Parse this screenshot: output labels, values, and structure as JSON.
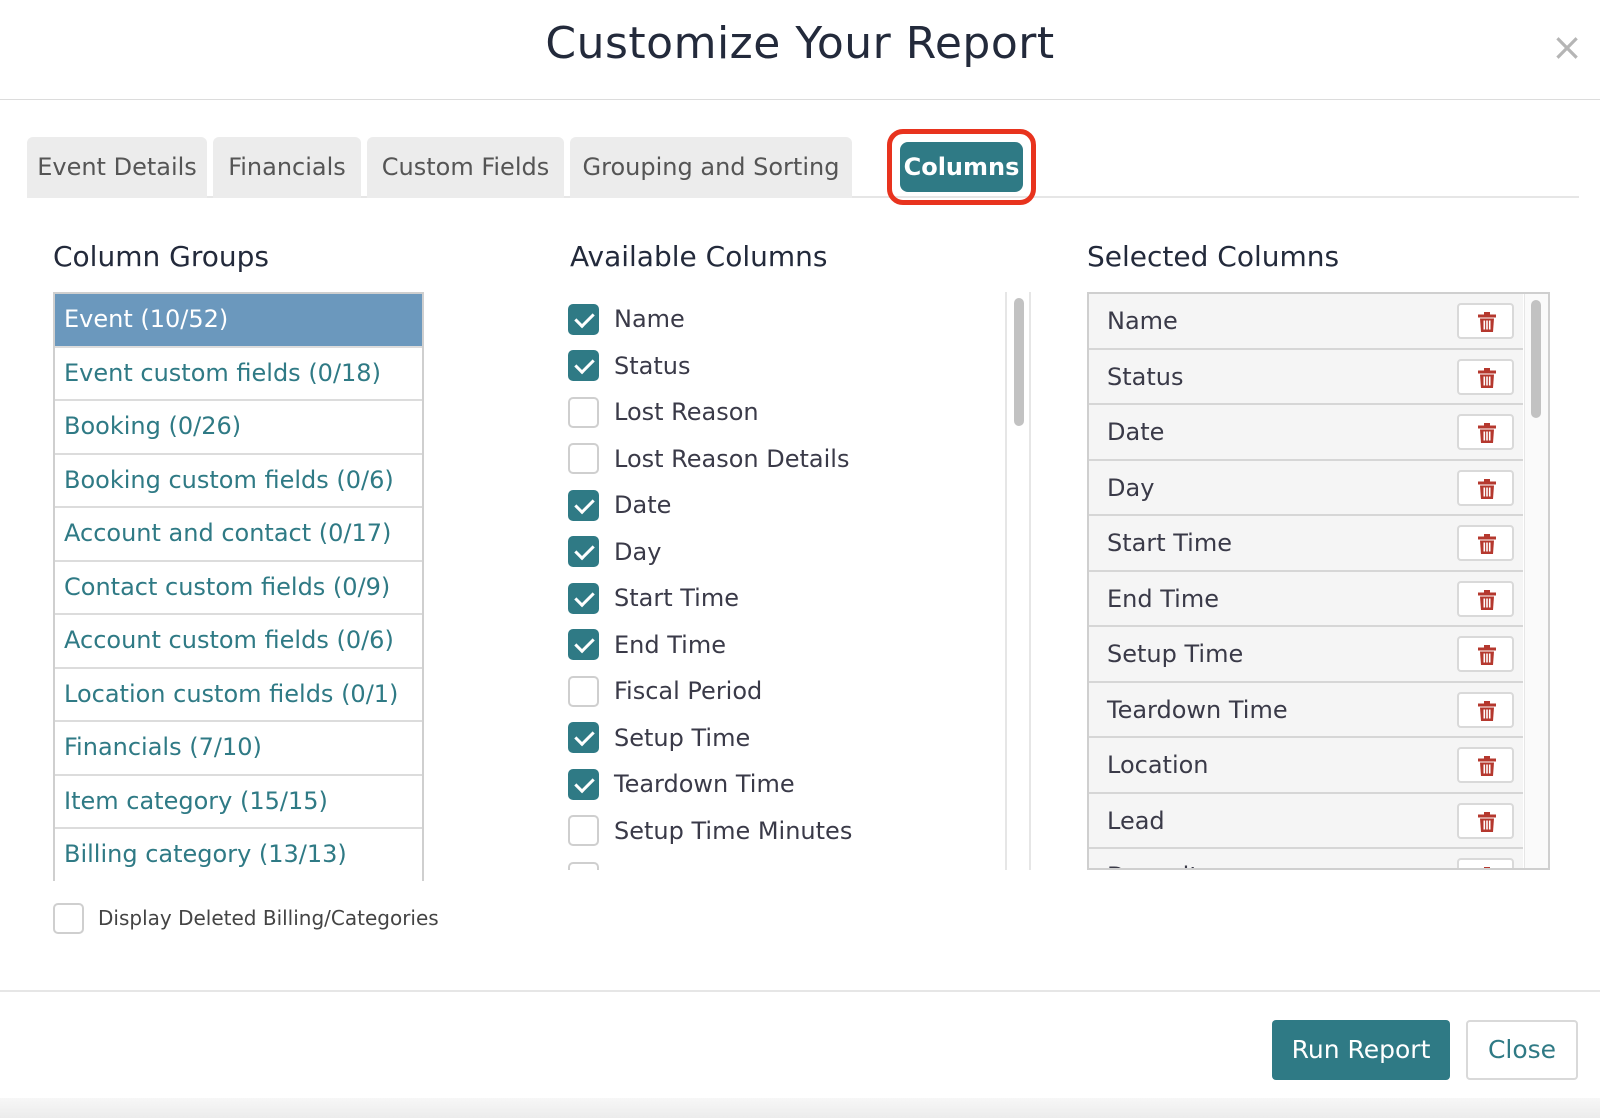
{
  "dialog": {
    "title": "Customize Your Report",
    "close_glyph": "×"
  },
  "tabs": [
    {
      "label": "Event Details"
    },
    {
      "label": "Financials"
    },
    {
      "label": "Custom Fields"
    },
    {
      "label": "Grouping and Sorting"
    },
    {
      "label": "Columns",
      "active": true
    }
  ],
  "column_groups": {
    "heading": "Column Groups",
    "items": [
      {
        "label": "Event (10/52)",
        "active": true
      },
      {
        "label": "Event custom fields (0/18)"
      },
      {
        "label": "Booking (0/26)"
      },
      {
        "label": "Booking custom fields (0/6)"
      },
      {
        "label": "Account and contact (0/17)"
      },
      {
        "label": "Contact custom fields (0/9)"
      },
      {
        "label": "Account custom fields (0/6)"
      },
      {
        "label": "Location custom fields (0/1)"
      },
      {
        "label": "Financials (7/10)"
      },
      {
        "label": "Item category (15/15)"
      },
      {
        "label": "Billing category (13/13)"
      }
    ],
    "display_deleted_label": "Display Deleted Billing/Categories",
    "display_deleted_checked": false
  },
  "available_columns": {
    "heading": "Available Columns",
    "items": [
      {
        "label": "Name",
        "checked": true
      },
      {
        "label": "Status",
        "checked": true
      },
      {
        "label": "Lost Reason",
        "checked": false
      },
      {
        "label": "Lost Reason Details",
        "checked": false
      },
      {
        "label": "Date",
        "checked": true
      },
      {
        "label": "Day",
        "checked": true
      },
      {
        "label": "Start Time",
        "checked": true
      },
      {
        "label": "End Time",
        "checked": true
      },
      {
        "label": "Fiscal Period",
        "checked": false
      },
      {
        "label": "Setup Time",
        "checked": true
      },
      {
        "label": "Teardown Time",
        "checked": true
      },
      {
        "label": "Setup Time Minutes",
        "checked": false
      }
    ]
  },
  "selected_columns": {
    "heading": "Selected Columns",
    "items": [
      {
        "label": "Name"
      },
      {
        "label": "Status"
      },
      {
        "label": "Date"
      },
      {
        "label": "Day"
      },
      {
        "label": "Start Time"
      },
      {
        "label": "End Time"
      },
      {
        "label": "Setup Time"
      },
      {
        "label": "Teardown Time"
      },
      {
        "label": "Location"
      },
      {
        "label": "Lead"
      },
      {
        "label": "Deposit"
      }
    ],
    "remove_icon": "trash-icon"
  },
  "footer": {
    "run_label": "Run Report",
    "close_label": "Close"
  },
  "colors": {
    "accent": "#2f7a85",
    "active_group": "#6b98bd",
    "highlight": "#e8331e",
    "trash": "#b5382e"
  }
}
